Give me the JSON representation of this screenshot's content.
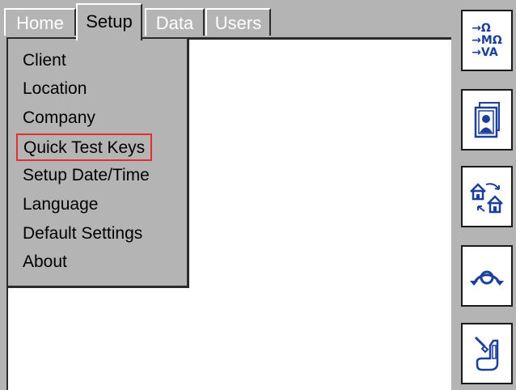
{
  "tabs": {
    "home": "Home",
    "setup": "Setup",
    "data": "Data",
    "users": "Users"
  },
  "menu": {
    "items": [
      "Client",
      "Location",
      "Company",
      "Quick Test Keys",
      "Setup Date/Time",
      "Language",
      "Default Settings",
      "About"
    ],
    "selected_index": 3
  },
  "toolbar": {
    "mode_line_1": "→Ω",
    "mode_line_2": "→MΩ",
    "mode_line_3": "→VA",
    "buttons": [
      "test-mode-icon",
      "contact-card-icon",
      "transfer-icon",
      "rotate-icon",
      "probe-icon"
    ]
  },
  "colors": {
    "background": "#b4b4b4",
    "panel": "#ffffff",
    "icon_blue": "#1c3f9c",
    "highlight": "#e03030"
  }
}
